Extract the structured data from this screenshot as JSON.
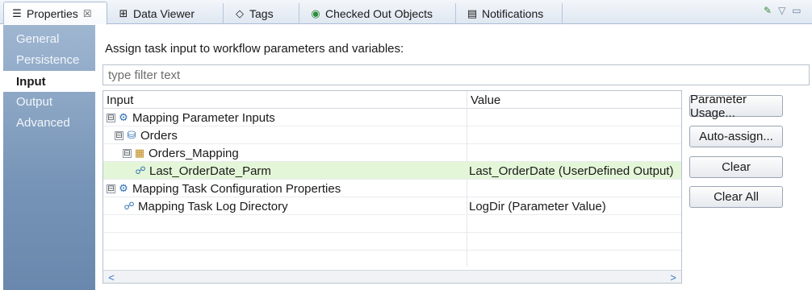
{
  "tabs": [
    {
      "label": "Properties",
      "icon": "properties-icon",
      "close": "☒"
    },
    {
      "label": "Data Viewer",
      "icon": "data-viewer-icon"
    },
    {
      "label": "Tags",
      "icon": "tag-icon"
    },
    {
      "label": "Checked Out Objects",
      "icon": "checked-out-icon"
    },
    {
      "label": "Notifications",
      "icon": "notifications-icon"
    }
  ],
  "nav": {
    "items": [
      "General",
      "Persistence",
      "Input",
      "Output",
      "Advanced"
    ],
    "selected": "Input"
  },
  "main": {
    "instruction": "Assign task input to workflow parameters and variables:",
    "filter_placeholder": "type filter text"
  },
  "table": {
    "headers": [
      "Input",
      "Value"
    ],
    "rows": [
      {
        "toggle": "⊟",
        "icon": "mapping-parameter-inputs-icon",
        "label": "Mapping Parameter Inputs",
        "value": ""
      },
      {
        "toggle": "⊟",
        "icon": "mapping-icon",
        "label": "Orders",
        "value": ""
      },
      {
        "toggle": "⊟",
        "icon": "mapping-task-icon",
        "label": "Orders_Mapping",
        "value": ""
      },
      {
        "toggle": "",
        "icon": "parameter-icon",
        "label": "Last_OrderDate_Parm",
        "value": "Last_OrderDate (UserDefined Output)",
        "selected": true
      },
      {
        "toggle": "⊟",
        "icon": "task-configuration-icon",
        "label": "Mapping Task Configuration Properties",
        "value": ""
      },
      {
        "toggle": "",
        "icon": "parameter-icon",
        "label": "Mapping Task Log Directory",
        "value": "LogDir (Parameter Value)"
      }
    ]
  },
  "buttons": {
    "parameter_usage": "Parameter Usage...",
    "auto_assign": "Auto-assign...",
    "clear": "Clear",
    "clear_all": "Clear All"
  }
}
